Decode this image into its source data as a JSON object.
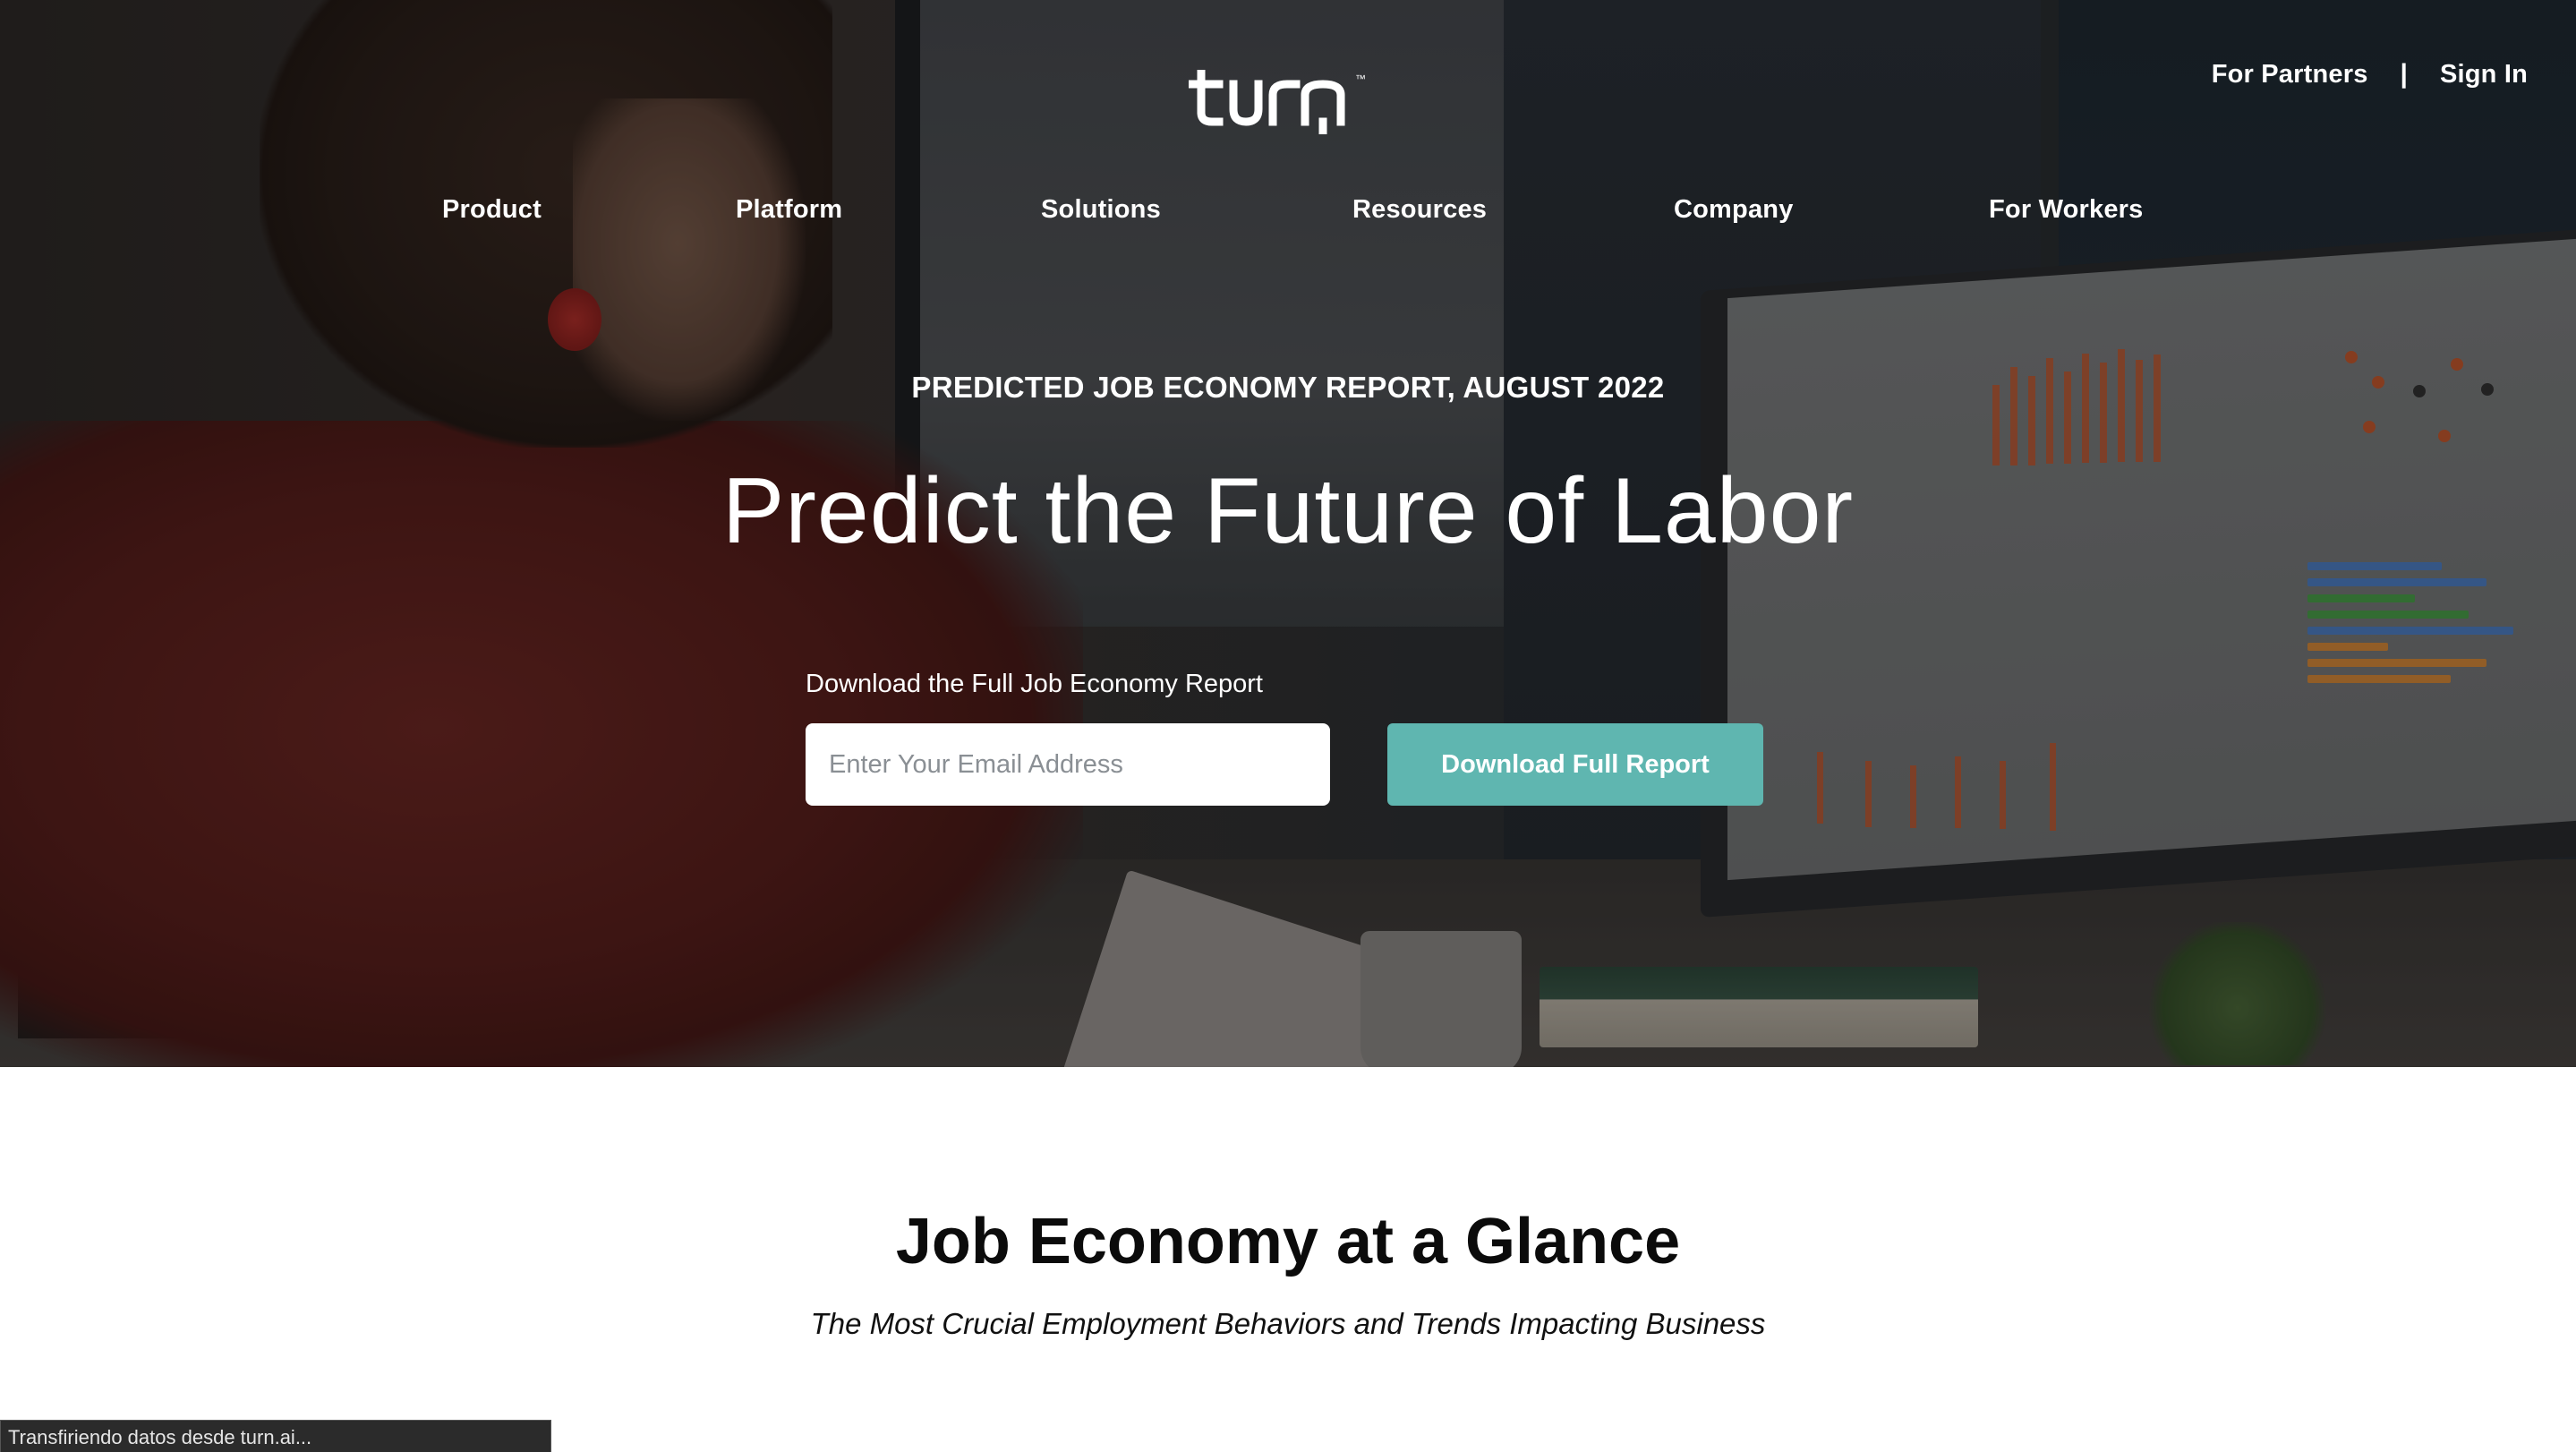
{
  "header": {
    "logo_text": "turn",
    "top_links": {
      "partners": "For Partners",
      "separator": "|",
      "sign_in": "Sign In"
    },
    "nav": [
      "Product",
      "Platform",
      "Solutions",
      "Resources",
      "Company",
      "For Workers"
    ]
  },
  "hero": {
    "eyebrow": "PREDICTED JOB ECONOMY REPORT, AUGUST 2022",
    "title": "Predict the Future of Labor",
    "form_label": "Download the Full Job Economy Report",
    "email_placeholder": "Enter Your Email Address",
    "email_value": "",
    "button_label": "Download Full Report",
    "accent_color": "#5fb6b0"
  },
  "section": {
    "title": "Job Economy at a Glance",
    "subtitle": "The Most Crucial Employment Behaviors and Trends Impacting Business"
  },
  "status_bar": {
    "text": "Transfiriendo datos desde turn.ai..."
  }
}
